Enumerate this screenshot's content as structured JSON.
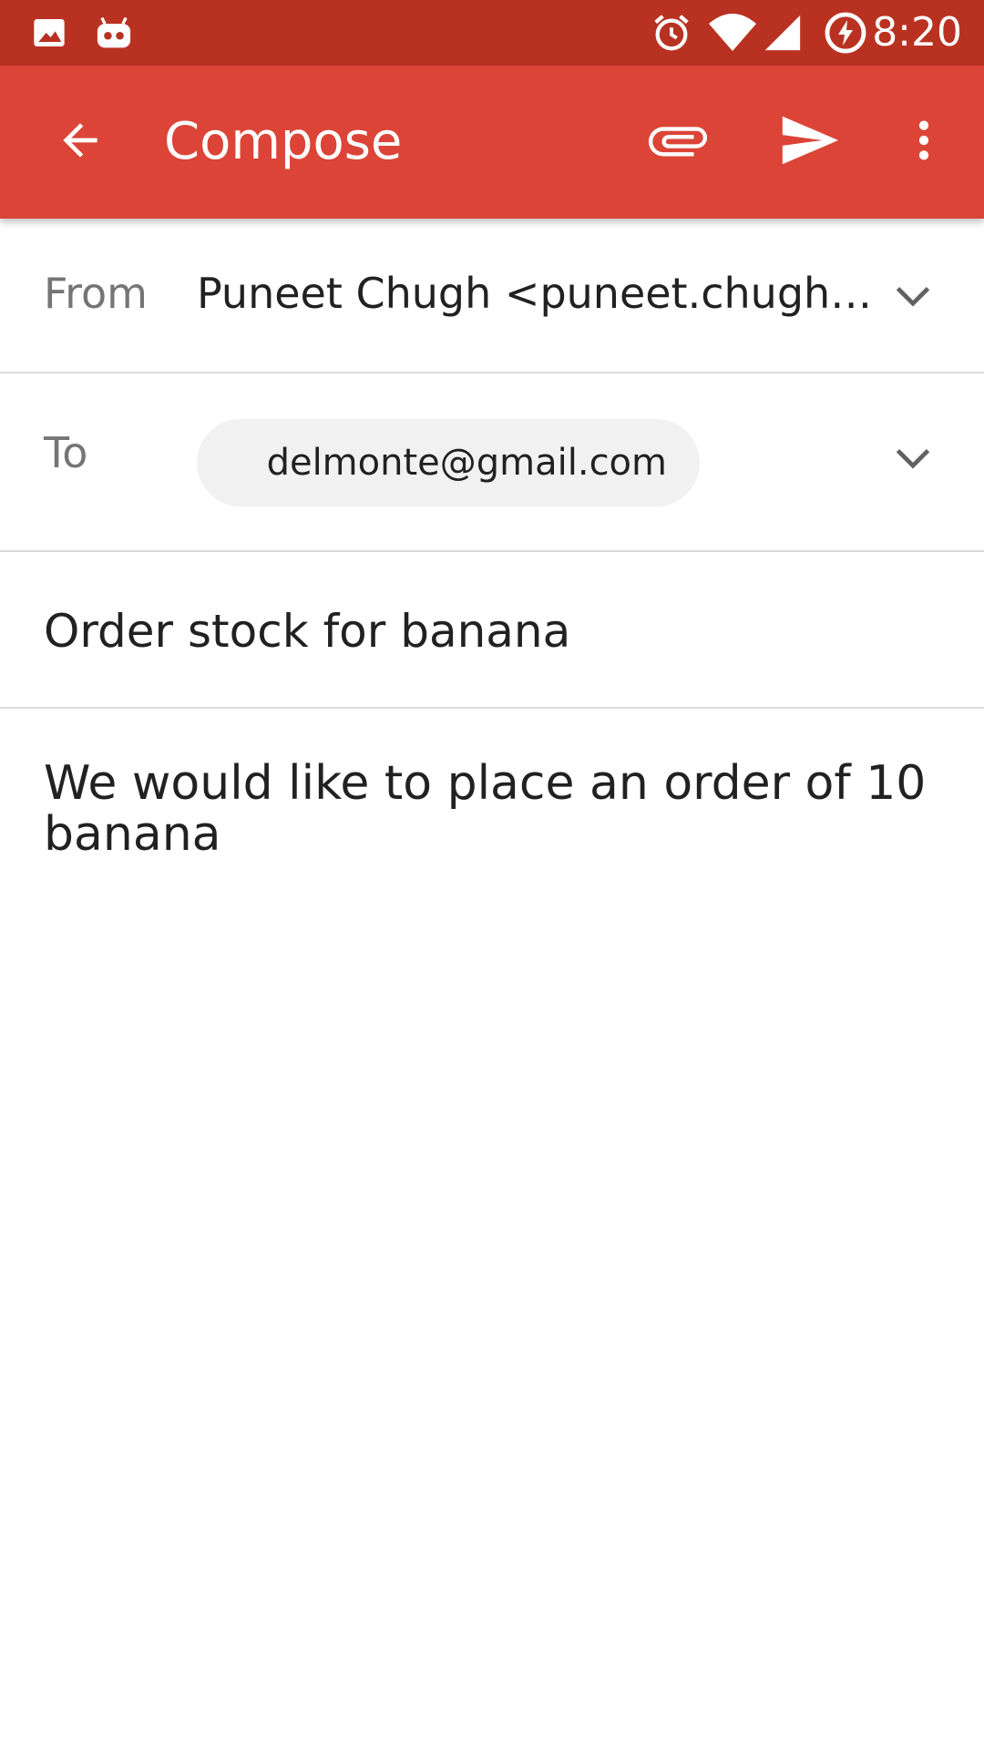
{
  "status_bar": {
    "time": "8:20",
    "icons": [
      "image-notification-icon",
      "android-robot-icon",
      "alarm-icon",
      "wifi-icon",
      "signal-icon",
      "battery-charging-icon"
    ],
    "color": "#b93221"
  },
  "app_bar": {
    "title": "Compose",
    "color": "#db4437",
    "actions": [
      "back-arrow-icon",
      "attach-icon",
      "send-icon",
      "more-vert-icon"
    ]
  },
  "from": {
    "label": "From",
    "value": "Puneet Chugh  <puneet.chugh…"
  },
  "to": {
    "label": "To",
    "recipient": "delmonte@gmail.com"
  },
  "subject": "Order stock for banana",
  "body": "We would like to place an order of 10 banana"
}
